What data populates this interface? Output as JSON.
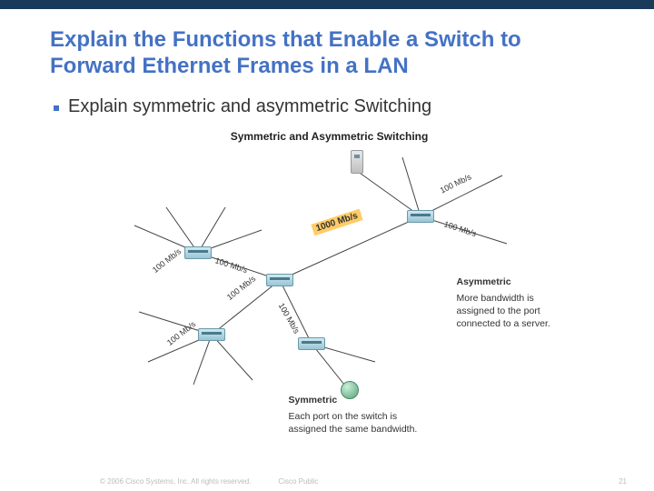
{
  "title": "Explain the Functions that Enable a Switch to Forward Ethernet Frames in a LAN",
  "bullet": "Explain symmetric and asymmetric Switching",
  "diagram": {
    "title": "Symmetric and Asymmetric Switching",
    "speed_100": "100 Mb/s",
    "speed_1000": "1000 Mb/s",
    "asymmetric": {
      "heading": "Asymmetric",
      "body": "More bandwidth is assigned to the port connected to a server."
    },
    "symmetric": {
      "heading": "Symmetric",
      "body": "Each port on the switch is assigned the same bandwidth."
    }
  },
  "footer": {
    "copyright": "© 2006 Cisco Systems, Inc. All rights reserved.",
    "tag": "Cisco Public",
    "page": "21"
  }
}
